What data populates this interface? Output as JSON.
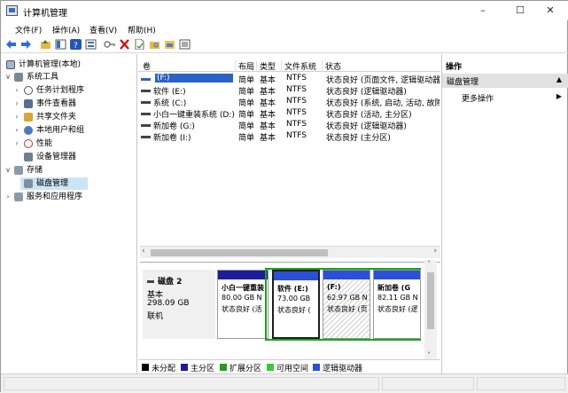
{
  "window": {
    "title": "计算机管理",
    "minimize": "–",
    "maximize": "☐",
    "close": "✕"
  },
  "menu": [
    {
      "label": "文件(F)"
    },
    {
      "label": "操作(A)"
    },
    {
      "label": "查看(V)"
    },
    {
      "label": "帮助(H)"
    }
  ],
  "toolbar_icons": [
    "back-icon",
    "forward-icon",
    "up-folder-icon",
    "show-hide-tree-icon",
    "help-icon",
    "properties-icon",
    "key-icon",
    "delete-icon",
    "document-icon",
    "folder-search-icon",
    "folder-open-icon",
    "list-view-icon"
  ],
  "tree": {
    "root": "计算机管理(本地)",
    "system_tools": "系统工具",
    "task_scheduler": "任务计划程序",
    "event_viewer": "事件查看器",
    "shared_folders": "共享文件夹",
    "local_users": "本地用户和组",
    "performance": "性能",
    "device_manager": "设备管理器",
    "storage": "存储",
    "disk_management": "磁盘管理",
    "services": "服务和应用程序"
  },
  "volumes": {
    "headers": [
      "卷",
      "布局",
      "类型",
      "文件系统",
      "状态"
    ],
    "rows": [
      {
        "name": "(F:)",
        "layout": "简单",
        "type": "基本",
        "fs": "NTFS",
        "status": "状态良好 (页面文件, 逻辑驱动器)"
      },
      {
        "name": "软件 (E:)",
        "layout": "简单",
        "type": "基本",
        "fs": "NTFS",
        "status": "状态良好 (逻辑驱动器)"
      },
      {
        "name": "系统 (C:)",
        "layout": "简单",
        "type": "基本",
        "fs": "NTFS",
        "status": "状态良好 (系统, 启动, 活动, 故障转储)"
      },
      {
        "name": "小白一键重装系统 (D:)",
        "layout": "简单",
        "type": "基本",
        "fs": "NTFS",
        "status": "状态良好 (活动, 主分区)"
      },
      {
        "name": "新加卷 (G:)",
        "layout": "简单",
        "type": "基本",
        "fs": "NTFS",
        "status": "状态良好 (逻辑驱动器)"
      },
      {
        "name": "新加卷 (I:)",
        "layout": "简单",
        "type": "基本",
        "fs": "NTFS",
        "status": "状态良好 (主分区)"
      }
    ]
  },
  "disk": {
    "name": "磁盘 2",
    "type": "基本",
    "size": "298.09 GB",
    "state": "联机",
    "partitions": [
      {
        "name": "小白一键重装",
        "size": "80.00 GB N",
        "status": "状态良好 (活"
      },
      {
        "name": "软件 (E:)",
        "size": "73.00 GB",
        "status": "状态良好 ("
      },
      {
        "name": "(F:)",
        "size": "62.97 GB N",
        "status": "状态良好 (页"
      },
      {
        "name": "新加卷 (G",
        "size": "82.11 GB N",
        "status": "状态良好 (逻"
      }
    ]
  },
  "legend": [
    {
      "label": "未分配",
      "color": "#000000"
    },
    {
      "label": "主分区",
      "color": "#1d1d9c"
    },
    {
      "label": "扩展分区",
      "color": "#1aa31a"
    },
    {
      "label": "可用空间",
      "color": "#33cc33"
    },
    {
      "label": "逻辑驱动器",
      "color": "#2b4fd6"
    }
  ],
  "actions": {
    "header": "操作",
    "section": "磁盘管理",
    "more": "更多操作"
  }
}
